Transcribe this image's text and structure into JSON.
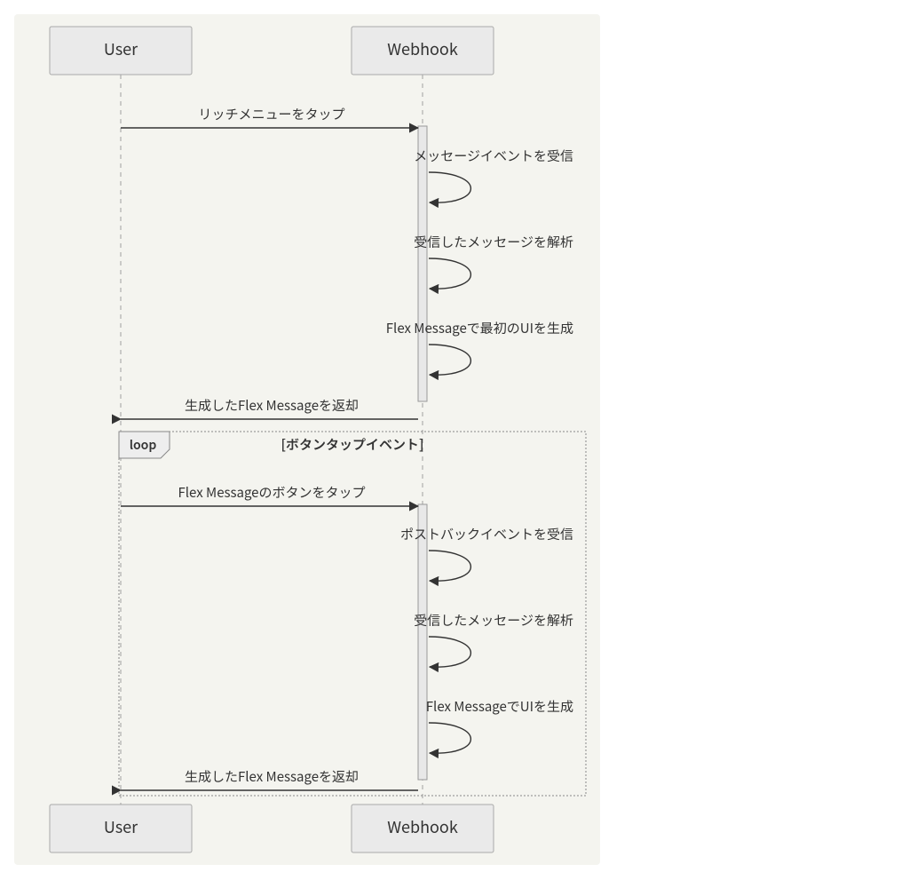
{
  "actors": {
    "user": "User",
    "webhook": "Webhook"
  },
  "messages": {
    "m1": "リッチメニューをタップ",
    "m2": "メッセージイベントを受信",
    "m3": "受信したメッセージを解析",
    "m4": "Flex Messageで最初のUIを生成",
    "m5": "生成したFlex Messageを返却",
    "m6": "Flex Messageのボタンをタップ",
    "m7": "ポストバックイベントを受信",
    "m8": "受信したメッセージを解析",
    "m9": "Flex MessageでUIを生成",
    "m10": "生成したFlex Messageを返却"
  },
  "loop": {
    "label": "loop",
    "condition": "[ボタンタップイベント]"
  }
}
